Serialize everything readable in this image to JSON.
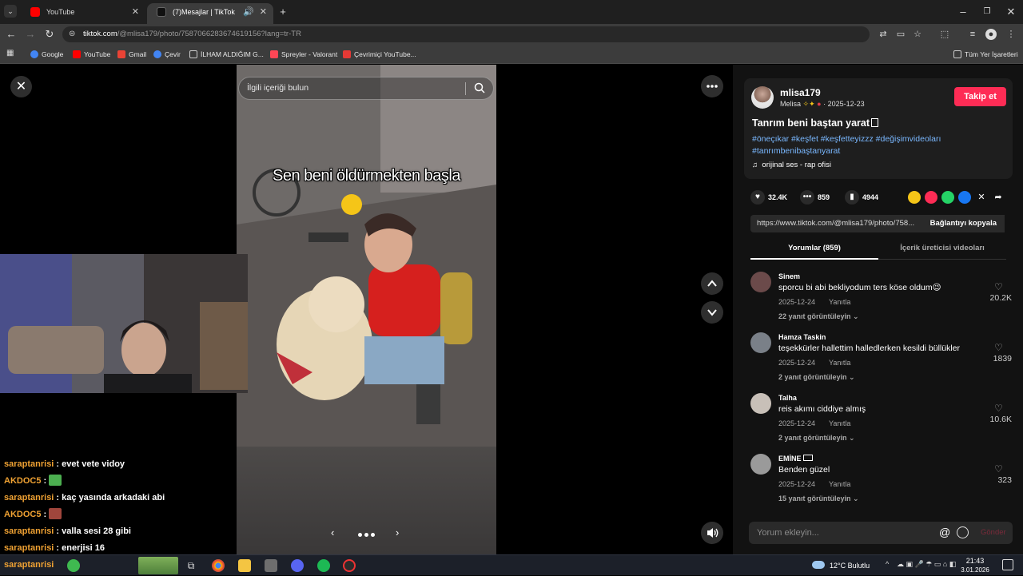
{
  "browser": {
    "tabs": [
      {
        "title": "YouTube",
        "active": false
      },
      {
        "title": "(7)Mesajlar | TikTok",
        "active": true
      }
    ],
    "url_host": "tiktok.com",
    "url_rest": "/@mlisa179/photo/7587066283674619156?lang=tr-TR",
    "bookmarks": [
      "Google",
      "YouTube",
      "Gmail",
      "Çevir",
      "İLHAM ALDIĞIM G...",
      "Spreyler - Valorant",
      "Çevrimiçi YouTube...",
      "Tüm Yer İşaretleri"
    ]
  },
  "viewer": {
    "search_placeholder": "İlgili içeriği bulun",
    "caption": "Sen beni öldürmekten başla"
  },
  "post": {
    "username": "mlisa179",
    "display_name": "Melisa",
    "date": "2025-12-23",
    "follow_label": "Takip et",
    "title": "Tanrım beni baştan yarat",
    "hashtags": "#öneçıkar #keşfet #keşfetteyizzz #değişimvideoları #tanrımbenibaştanyarat",
    "music": "orijinal ses - rap ofisi",
    "likes": "32.4K",
    "comments_count": "859",
    "saves": "4944",
    "link": "https://www.tiktok.com/@mlisa179/photo/758...",
    "copy_label": "Bağlantıyı kopyala",
    "tab_comments": "Yorumlar (859)",
    "tab_creator": "İçerik üreticisi videoları"
  },
  "comments": [
    {
      "name": "Sinem",
      "text": "sporcu bi abi bekliyodum ters köse oldum😉",
      "date": "2025-12-24",
      "reply": "Yanıtla",
      "replies": "22 yanıt görüntüleyin",
      "likes": "20.2K",
      "avatar_color": "#6b4a4a"
    },
    {
      "name": "Hamza Taskin",
      "text": "teşekkürler hallettim halledlerken kesildi büllükler",
      "date": "2025-12-24",
      "reply": "Yanıtla",
      "replies": "2 yanıt görüntüleyin",
      "likes": "1839",
      "avatar_color": "#7a8088"
    },
    {
      "name": "Talha",
      "text": "reis akımı ciddiye almış",
      "date": "2025-12-24",
      "reply": "Yanıtla",
      "replies": "2 yanıt görüntüleyin",
      "likes": "10.6K",
      "avatar_color": "#c8c0b8"
    },
    {
      "name": "EMİNE",
      "text": "Benden güzel",
      "date": "2025-12-24",
      "reply": "Yanıtla",
      "replies": "15 yanıt görüntüleyin",
      "likes": "323",
      "avatar_color": "#9a9a9a"
    }
  ],
  "comment_box": {
    "placeholder": "Yorum ekleyin...",
    "send": "Gönder"
  },
  "chat": [
    {
      "user": "saraptanrisi",
      "msg": "evet vete vidoy",
      "emote": ""
    },
    {
      "user": "AKDOC5",
      "msg": "",
      "emote": "#4caf50"
    },
    {
      "user": "saraptanrisi",
      "msg": "kaç yasında arkadaki abi",
      "emote": ""
    },
    {
      "user": "AKDOC5",
      "msg": "",
      "emote": "#a0463c"
    },
    {
      "user": "saraptanrisi",
      "msg": "valla sesi 28 gibi",
      "emote": ""
    },
    {
      "user": "saraptanrisi",
      "msg": "enerjisi 16",
      "emote": ""
    }
  ],
  "taskbar": {
    "weather": "12°C  Bulutlu",
    "time": "21:43",
    "date": "3.01.2026",
    "search_label": "saraptanrisi"
  }
}
